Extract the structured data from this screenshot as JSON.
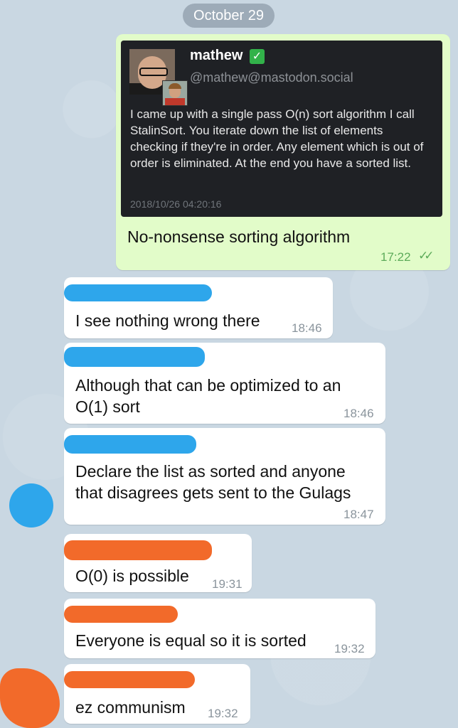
{
  "date_divider": "October 29",
  "forwarded": {
    "card": {
      "name": "mathew",
      "verified_icon": "check-mark-icon",
      "handle": "@mathew@mastodon.social",
      "text": "I came up with a single pass O(n) sort algorithm I call StalinSort. You iterate down the list of elements checking if they're in order. Any element which is out of order is eliminated. At the end you have a sorted list.",
      "timestamp": "2018/10/26 04:20:16"
    },
    "caption": "No-nonsense sorting algorithm",
    "time": "17:22",
    "read_icon": "double-check-icon"
  },
  "messages": [
    {
      "text": "I see nothing wrong there",
      "time": "18:46",
      "redact_color": "#2ea6eb"
    },
    {
      "text": "Although that can be optimized to an\nO(1) sort",
      "time": "18:46",
      "redact_color": "#2ea6eb"
    },
    {
      "text": "Declare the list as sorted and anyone\nthat disagrees gets sent to the Gulags",
      "time": "18:47",
      "redact_color": "#2ea6eb"
    },
    {
      "text": "O(0) is possible",
      "time": "19:31",
      "redact_color": "#f26a2a"
    },
    {
      "text": "Everyone is equal so it is sorted",
      "time": "19:32",
      "redact_color": "#f26a2a"
    },
    {
      "text": "ez communism",
      "time": "19:32",
      "redact_color": "#f26a2a"
    }
  ],
  "colors": {
    "outgoing_bubble": "#e2fcc9",
    "incoming_bubble": "#ffffff",
    "background": "#c9d7e2",
    "read_tick": "#5dab5a"
  }
}
